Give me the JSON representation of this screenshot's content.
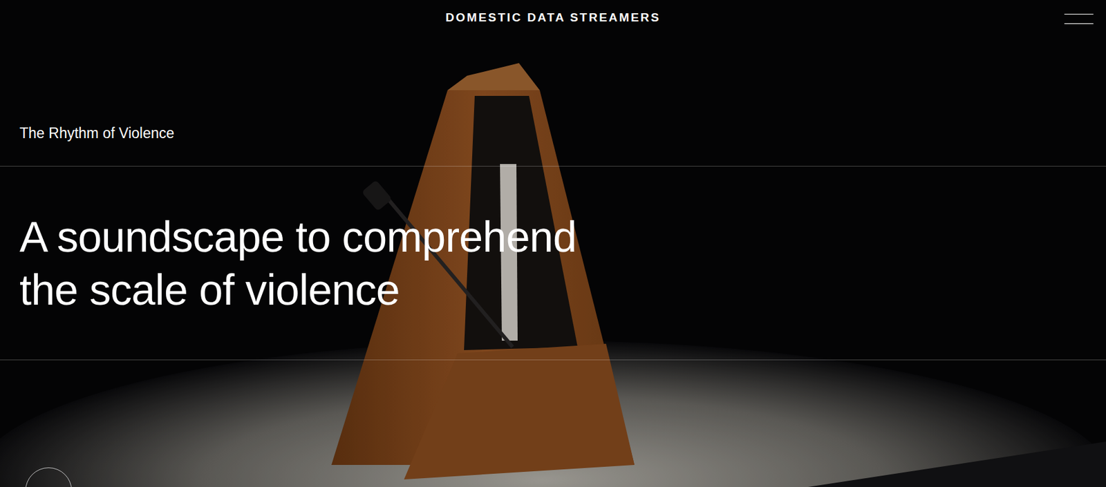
{
  "header": {
    "logo": "DOMESTIC DATA STREAMERS"
  },
  "project": {
    "title": "The Rhythm of Violence"
  },
  "hero": {
    "heading_lines": [
      "A soundscape to comprehend",
      "the scale of violence"
    ]
  }
}
